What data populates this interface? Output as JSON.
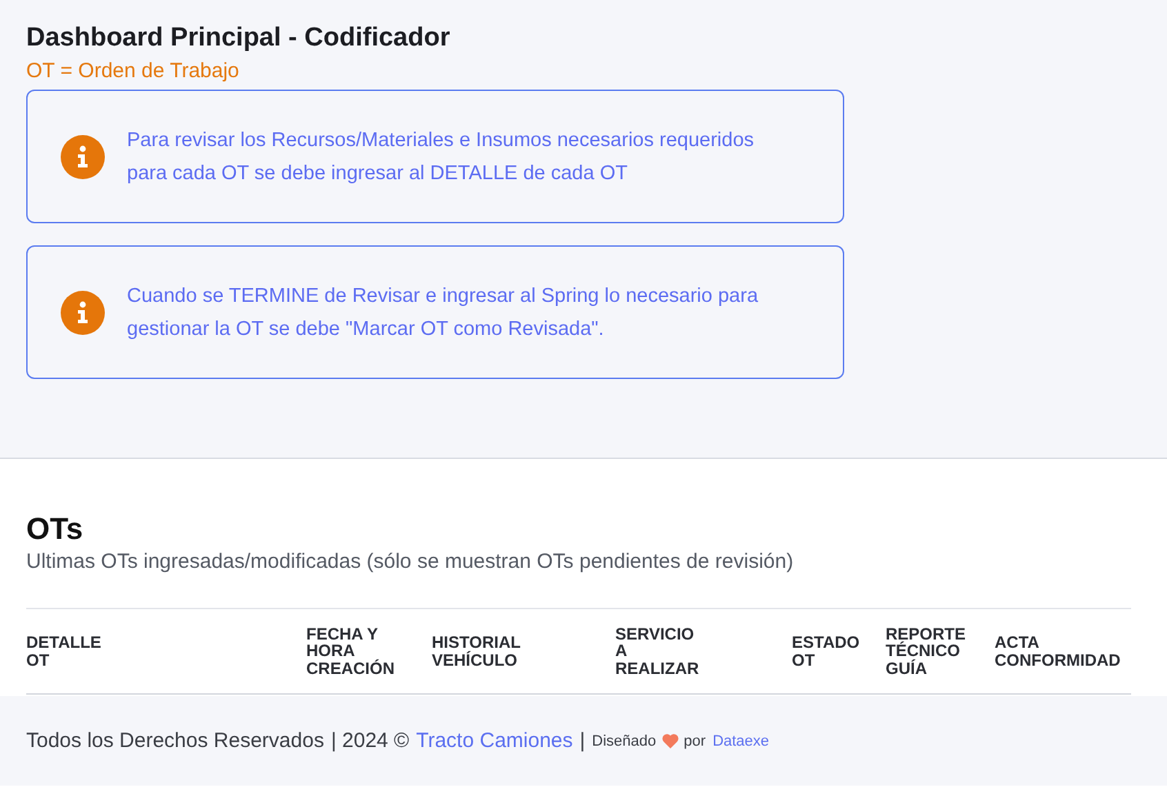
{
  "header": {
    "title": "Dashboard Principal - Codificador",
    "subtitle": "OT = Orden de Trabajo"
  },
  "alerts": [
    {
      "text": "Para revisar los Recursos/Materiales e Insumos necesarios requeridos para cada OT se debe ingresar al DETALLE de cada OT"
    },
    {
      "text": "Cuando se TERMINE de Revisar e ingresar al Spring lo necesario para gestionar la OT se debe \"Marcar OT como Revisada\"."
    }
  ],
  "section": {
    "title": "OTs",
    "subtitle": "Ultimas OTs ingresadas/modificadas (sólo se muestran OTs pendientes de revisión)"
  },
  "table": {
    "columns": [
      "DETALLE OT",
      "FECHA Y HORA CREACIÓN",
      "HISTORIAL VEHÍCULO",
      "SERVICIO A REALIZAR",
      "ESTADO OT",
      "REPORTE TÉCNICO GUÍA",
      "ACTA CONFORMIDAD"
    ]
  },
  "footer": {
    "rights": "Todos los Derechos Reservados",
    "year": "| 2024 ©",
    "company": "Tracto Camiones",
    "separator": "|",
    "designed": "Diseñado",
    "by": "por",
    "designer": "Dataexe"
  }
}
